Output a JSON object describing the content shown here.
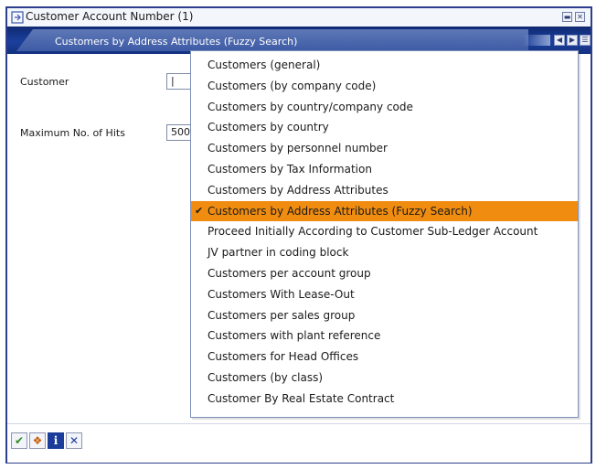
{
  "window": {
    "title": "Customer Account Number (1)",
    "min_symbol": "▬",
    "close_symbol": "✕"
  },
  "header": {
    "title": "Customers by Address Attributes (Fuzzy Search)",
    "nav_left_symbol": "◀",
    "nav_right_symbol": "▶",
    "nav_list_symbol": "☰"
  },
  "form": {
    "customer_label": "Customer",
    "customer_value": "|",
    "max_hits_label": "Maximum No. of Hits",
    "max_hits_value": "500"
  },
  "dropdown": {
    "items": [
      {
        "label": "Customers (general)",
        "selected": false
      },
      {
        "label": "Customers (by company code)",
        "selected": false
      },
      {
        "label": "Customers by country/company code",
        "selected": false
      },
      {
        "label": "Customers by country",
        "selected": false
      },
      {
        "label": "Customers by personnel number",
        "selected": false
      },
      {
        "label": "Customers by Tax Information",
        "selected": false
      },
      {
        "label": "Customers by Address Attributes",
        "selected": false
      },
      {
        "label": "Customers by Address Attributes (Fuzzy Search)",
        "selected": true
      },
      {
        "label": "Proceed Initially According to Customer Sub-Ledger Account",
        "selected": false
      },
      {
        "label": "JV partner in coding block",
        "selected": false
      },
      {
        "label": "Customers per account group",
        "selected": false
      },
      {
        "label": "Customers With Lease-Out",
        "selected": false
      },
      {
        "label": "Customers per sales group",
        "selected": false
      },
      {
        "label": "Customers with plant reference",
        "selected": false
      },
      {
        "label": "Customers for Head Offices",
        "selected": false
      },
      {
        "label": "Customers (by class)",
        "selected": false
      },
      {
        "label": "Customer By Real Estate Contract",
        "selected": false
      }
    ],
    "check_symbol": "✔"
  },
  "toolbar": {
    "buttons": [
      {
        "name": "continue-check-icon",
        "symbol": "✔",
        "color": "#2e8b1e"
      },
      {
        "name": "multiple-selection-icon",
        "symbol": "❖",
        "color": "#c85a00"
      },
      {
        "name": "information-icon",
        "symbol": "i",
        "color": "#1c3c9a"
      },
      {
        "name": "cancel-icon",
        "symbol": "✕",
        "color": "#1c3c9a"
      }
    ]
  },
  "colors": {
    "accent": "#1b3f9c",
    "selection": "#f08c10"
  }
}
